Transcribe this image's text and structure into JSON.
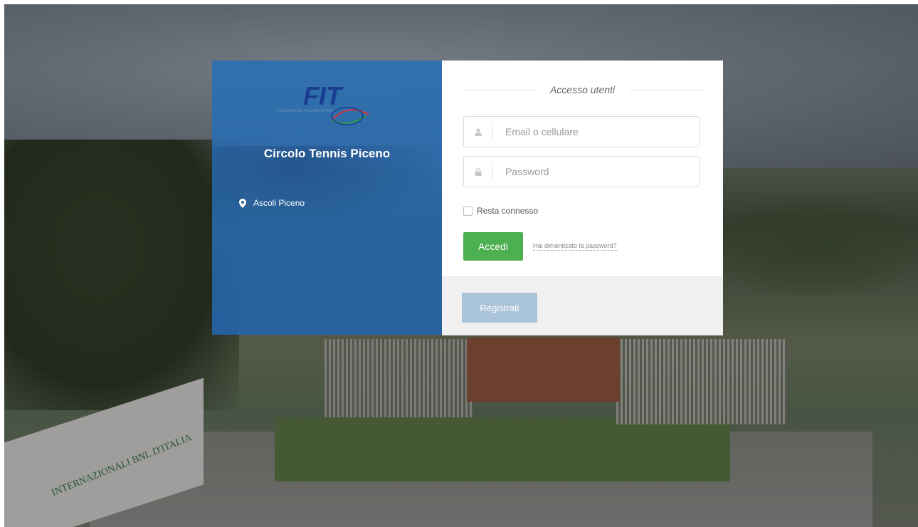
{
  "club": {
    "logo_text": "FIT",
    "logo_subtext": "FEDERAZIONE ITALIANA TENNIS",
    "name": "Circolo Tennis Piceno",
    "location": "Ascoli Piceno"
  },
  "login": {
    "heading": "Accesso utenti",
    "email_placeholder": "Email o cellulare",
    "password_placeholder": "Password",
    "remember_label": "Resta connesso",
    "remember_checked": false,
    "submit_label": "Accedi",
    "forgot_label": "Hai dimenticato la password?",
    "register_label": "Registrati"
  },
  "background": {
    "banner_text": "INTERNAZIONALI BNL D'ITALIA"
  },
  "colors": {
    "panel_blue": "#2c6fb2",
    "accent_green": "#4caf50",
    "register_button": "#a9c4d9"
  },
  "icons": {
    "user": "user-icon",
    "lock": "lock-icon",
    "pin": "map-pin-icon"
  }
}
